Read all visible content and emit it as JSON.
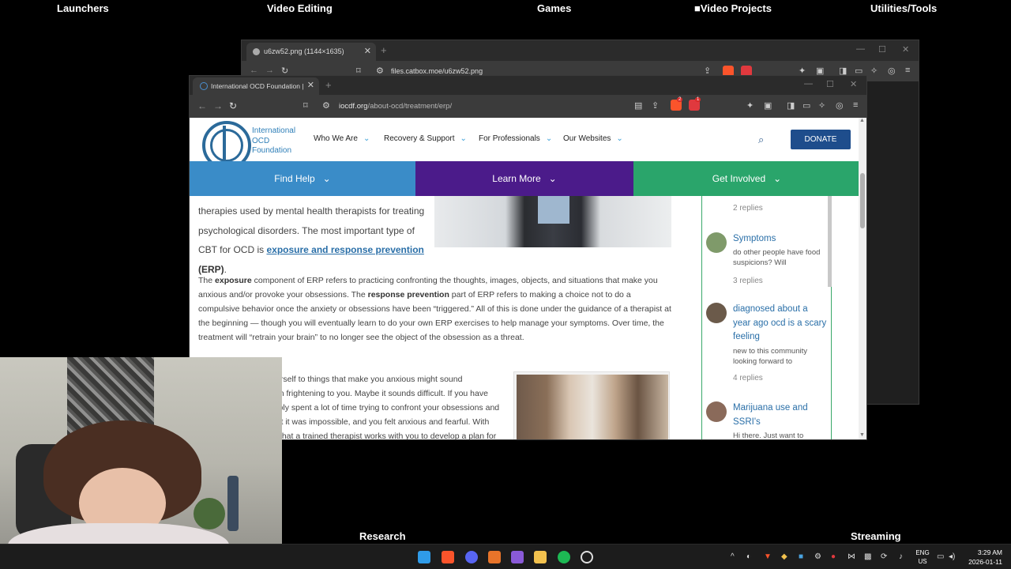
{
  "desktop": {
    "labels": [
      "Launchers",
      "Video Editing",
      "Games",
      "Video Projects",
      "Utilities/Tools",
      "Research",
      "Streaming"
    ]
  },
  "back_browser": {
    "tab_title": "u6zw52.png (1144×1635)",
    "url": "files.catbox.moe/u6zw52.png"
  },
  "front_browser": {
    "tab_title": "International OCD Foundation | E",
    "url_domain": "iocdf.org",
    "url_path": "/about-ocd/treatment/erp/",
    "shield_badge": "2",
    "rewards_badge": "1"
  },
  "site": {
    "logo_lines": [
      "International",
      "OCD",
      "Foundation"
    ],
    "nav": [
      "Who We Are",
      "Recovery & Support",
      "For Professionals",
      "Our Websites"
    ],
    "donate": "DONATE",
    "bigbar": [
      "Find Help",
      "Learn More",
      "Get Involved"
    ],
    "colors": {
      "find_help": "#3a8cc8",
      "learn_more": "#4b1b8a",
      "get_involved": "#2aa56b",
      "donate": "#1e4d8c"
    },
    "para1": {
      "pre": "therapies used by mental health therapists for treating psychological disorders. The most important type of CBT for OCD is ",
      "link": "exposure and response prevention",
      "post_bold": "(ERP)",
      "end": "."
    },
    "para2": {
      "a": "The ",
      "b1": "exposure",
      "c": " component of ERP refers to practicing confronting the thoughts, images, objects, and situations that make you anxious and/or provoke your obsessions. The ",
      "b2": "response prevention",
      "d": " part of ERP refers to making a choice not to do a compulsive behavior once the anxiety or obsessions have been “triggered.” All of this is done under the guidance of a therapist at the beginning — though you will eventually learn to do your own ERP exercises to help manage your symptoms. Over time, the treatment will “retrain your brain” to no longer see the object of the obsession as a threat."
    },
    "para3": "carefully exposing yourself to things that make you anxious might sound counterintuitive or even frightening to you. Maybe it sounds difficult. If you have OCD, you have probably spent a lot of time trying to confront your obsessions and anxiety only to see that it was impossible, and you felt anxious and fearful. With ERP, the difference is that a trained therapist works with you to develop a plan for exposure. Then, that therapist"
  },
  "forum": {
    "posts": [
      {
        "title": "",
        "excerpt": "",
        "replies": "2 replies"
      },
      {
        "title": "Symptoms",
        "excerpt": "do other people have food suspicions? Will",
        "replies": "3 replies"
      },
      {
        "title": "diagnosed about a year ago ocd is a scary feeling",
        "excerpt": "new to this community looking forward to",
        "replies": "4 replies"
      },
      {
        "title": "Marijuana use and SSRI's",
        "excerpt": "Hi there. Just want to",
        "replies": ""
      }
    ]
  },
  "taskbar": {
    "lang_top": "ENG",
    "lang_bottom": "US",
    "time": "3:29 AM",
    "date": "2026-01-11"
  }
}
